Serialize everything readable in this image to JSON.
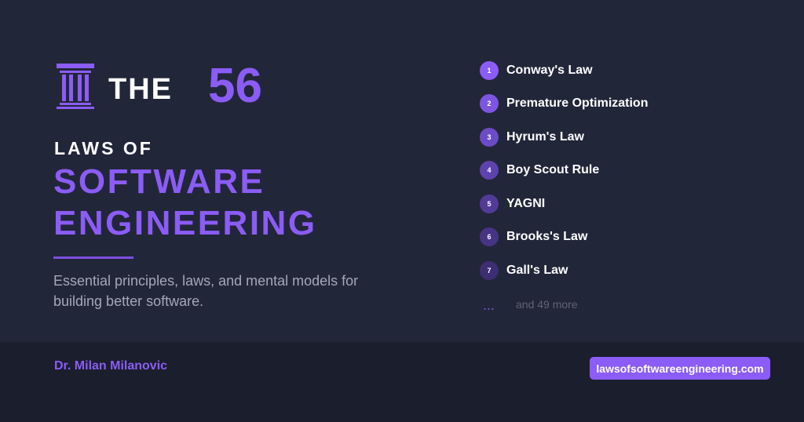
{
  "header": {
    "the_label": "THE",
    "count": "56",
    "laws_of": "LAWS OF",
    "title_line1": "SOFTWARE",
    "title_line2": "ENGINEERING",
    "subtitle": "Essential principles, laws, and mental models for building better software."
  },
  "laws": [
    {
      "number": "1",
      "name": "Conway's Law"
    },
    {
      "number": "2",
      "name": "Premature Optimization"
    },
    {
      "number": "3",
      "name": "Hyrum's Law"
    },
    {
      "number": "4",
      "name": "Boy Scout Rule"
    },
    {
      "number": "5",
      "name": "YAGNI"
    },
    {
      "number": "6",
      "name": "Brooks's Law"
    },
    {
      "number": "7",
      "name": "Gall's Law"
    }
  ],
  "more": {
    "dots": "...",
    "label": "and 49 more"
  },
  "footer": {
    "author": "Dr. Milan Milanovic",
    "site": "lawsofsoftwareengineering.com"
  },
  "icons": {
    "logo": "pillar-icon"
  },
  "colors": {
    "accent": "#8b5cf6",
    "background": "#222639",
    "footer_background": "#1b1e2c",
    "badge_gradient": [
      "#8b5cf6",
      "#7c55e0",
      "#6c4bc6",
      "#5e42ad",
      "#523b97",
      "#473484",
      "#3d2e73"
    ]
  }
}
